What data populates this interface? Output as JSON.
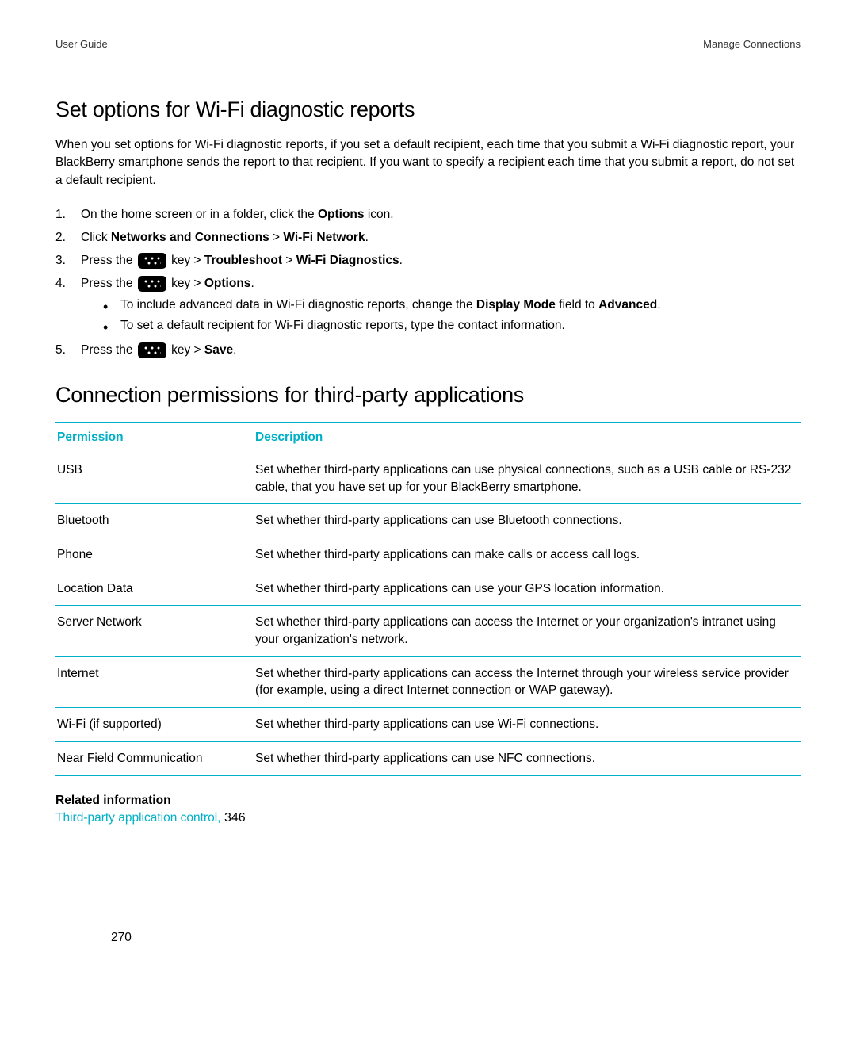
{
  "header": {
    "left": "User Guide",
    "right": "Manage Connections"
  },
  "section1": {
    "heading": "Set options for Wi-Fi diagnostic reports",
    "intro": "When you set options for Wi-Fi diagnostic reports, if you set a default recipient, each time that you submit a Wi-Fi diagnostic report, your BlackBerry smartphone sends the report to that recipient. If you want to specify a recipient each time that you submit a report, do not set a default recipient.",
    "steps": {
      "s1_pre": "On the home screen or in a folder, click the ",
      "s1_bold": "Options",
      "s1_post": " icon.",
      "s2_pre": "Click ",
      "s2_b1": "Networks and Connections",
      "s2_mid": " > ",
      "s2_b2": "Wi-Fi Network",
      "s2_post": ".",
      "s3_pre": "Press the ",
      "s3_key": " key > ",
      "s3_b1": "Troubleshoot",
      "s3_mid": " > ",
      "s3_b2": "Wi-Fi Diagnostics",
      "s3_post": ".",
      "s4_pre": "Press the ",
      "s4_key": " key > ",
      "s4_b1": "Options",
      "s4_post": ".",
      "s4_bullet1_pre": "To include advanced data in Wi-Fi diagnostic reports, change the ",
      "s4_bullet1_b1": "Display Mode",
      "s4_bullet1_mid": " field to ",
      "s4_bullet1_b2": "Advanced",
      "s4_bullet1_post": ".",
      "s4_bullet2": "To set a default recipient for Wi-Fi diagnostic reports, type the contact information.",
      "s5_pre": "Press the ",
      "s5_key": " key > ",
      "s5_b1": "Save",
      "s5_post": "."
    }
  },
  "section2": {
    "heading": "Connection permissions for third-party applications",
    "table": {
      "headers": {
        "permission": "Permission",
        "description": "Description"
      },
      "rows": [
        {
          "permission": "USB",
          "description": "Set whether third-party applications can use physical connections, such as a USB cable or RS-232 cable, that you have set up for your BlackBerry smartphone."
        },
        {
          "permission": "Bluetooth",
          "description": "Set whether third-party applications can use Bluetooth connections."
        },
        {
          "permission": "Phone",
          "description": "Set whether third-party applications can make calls or access call logs."
        },
        {
          "permission": "Location Data",
          "description": "Set whether third-party applications can use your GPS location information."
        },
        {
          "permission": "Server Network",
          "description": "Set whether third-party applications can access the Internet or your organization's intranet using your organization's network."
        },
        {
          "permission": "Internet",
          "description": "Set whether third-party applications can access the Internet through your wireless service provider (for example, using a direct Internet connection or WAP gateway)."
        },
        {
          "permission": "Wi-Fi (if supported)",
          "description": "Set whether third-party applications can use Wi-Fi connections."
        },
        {
          "permission": "Near Field Communication",
          "description": "Set whether third-party applications can use NFC connections."
        }
      ]
    }
  },
  "related": {
    "heading": "Related information",
    "link_text": "Third-party application control,",
    "link_page": " 346"
  },
  "page_number": "270"
}
